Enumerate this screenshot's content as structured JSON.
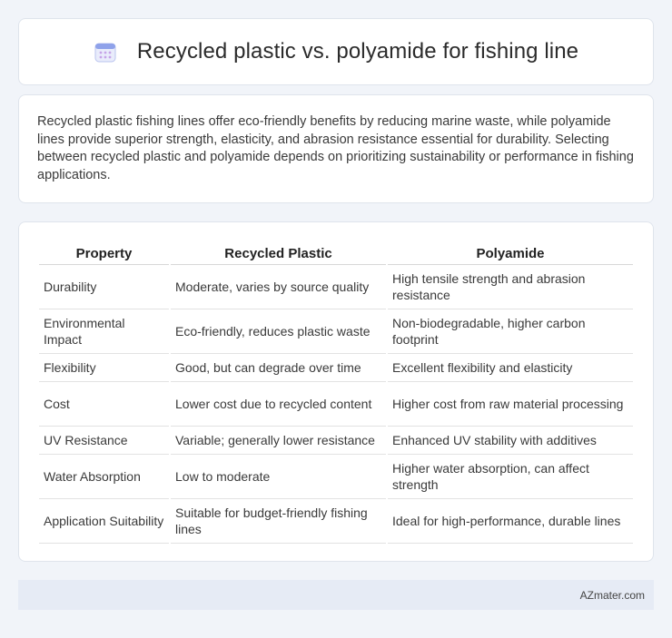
{
  "header": {
    "title": "Recycled plastic vs. polyamide for fishing line",
    "icon": "calendar-icon"
  },
  "intro": {
    "text": "Recycled plastic fishing lines offer eco-friendly benefits by reducing marine waste, while polyamide lines provide superior strength, elasticity, and abrasion resistance essential for durability. Selecting between recycled plastic and polyamide depends on prioritizing sustainability or performance in fishing applications."
  },
  "table": {
    "headers": [
      "Property",
      "Recycled Plastic",
      "Polyamide"
    ],
    "rows": [
      [
        "Durability",
        "Moderate, varies by source quality",
        "High tensile strength and abrasion resistance"
      ],
      [
        "Environmental Impact",
        "Eco-friendly, reduces plastic waste",
        "Non-biodegradable, higher carbon footprint"
      ],
      [
        "Flexibility",
        "Good, but can degrade over time",
        "Excellent flexibility and elasticity"
      ],
      [
        "Cost",
        "Lower cost due to recycled content",
        "Higher cost from raw material processing"
      ],
      [
        "UV Resistance",
        "Variable; generally lower resistance",
        "Enhanced UV stability with additives"
      ],
      [
        "Water Absorption",
        "Low to moderate",
        "Higher water absorption, can affect strength"
      ],
      [
        "Application Suitability",
        "Suitable for budget-friendly fishing lines",
        "Ideal for high-performance, durable lines"
      ]
    ]
  },
  "footer": {
    "text": "AZmater.com"
  },
  "colors": {
    "background": "#f1f4f9",
    "card": "#ffffff",
    "footer_bg": "#e6ebf5",
    "icon_accent": "#7b8fe0"
  }
}
